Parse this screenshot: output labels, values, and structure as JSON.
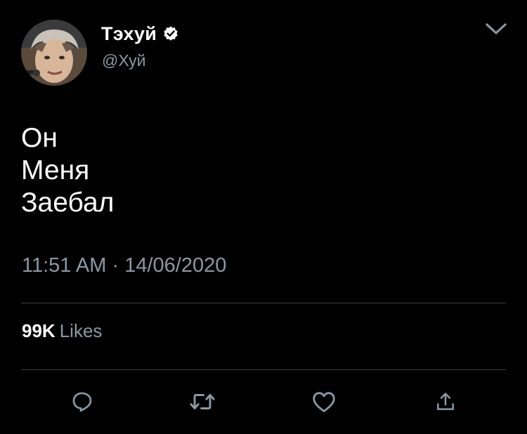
{
  "author": {
    "display_name": "Тэхуй",
    "handle": "@Хуй",
    "verified": true,
    "avatar_icon": "profile-photo"
  },
  "tweet": {
    "lines": [
      "Он",
      "Меня",
      "Заебал"
    ],
    "time": "11:51 AM",
    "separator": "·",
    "date": "14/06/2020"
  },
  "stats": {
    "likes_count": "99K",
    "likes_label": "Likes"
  },
  "actions": [
    {
      "icon": "reply-icon"
    },
    {
      "icon": "retweet-icon"
    },
    {
      "icon": "like-icon"
    },
    {
      "icon": "share-icon"
    }
  ],
  "colors": {
    "background": "#000000",
    "text": "#ffffff",
    "secondary_text": "#8b98a5",
    "divider": "#3a3f44",
    "icon": "#8b98a5"
  }
}
